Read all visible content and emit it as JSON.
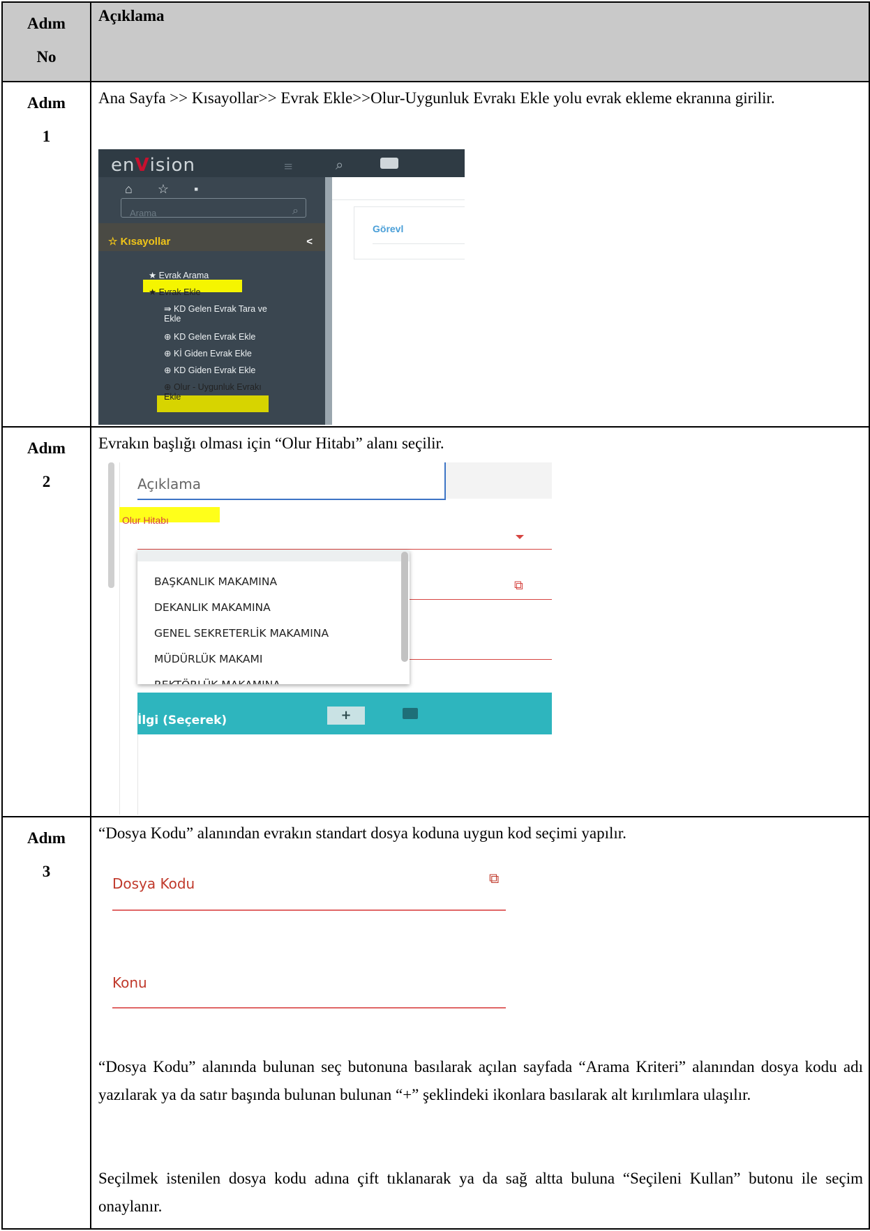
{
  "table": {
    "header": {
      "col1_line1": "Adım",
      "col1_line2": "No",
      "col2": "Açıklama"
    },
    "steps": [
      {
        "label_line1": "Adım",
        "label_line2": "1",
        "text": "Ana Sayfa >> Kısayollar>> Evrak Ekle>>Olur-Uygunluk Evrakı Ekle yolu evrak ekleme ekranına girilir."
      },
      {
        "label_line1": "Adım",
        "label_line2": "2",
        "text": "Evrakın başlığı olması için “Olur Hitabı” alanı seçilir."
      },
      {
        "label_line1": "Adım",
        "label_line2": "3",
        "text": "“Dosya Kodu” alanından evrakın standart dosya koduna uygun kod seçimi yapılır.",
        "text_after": "“Dosya Kodu” alanında bulunan seç butonuna basılarak açılan sayfada “Arama Kriteri” alanından dosya kodu adı yazılarak ya da satır başında bulunan bulunan “+” şeklindeki ikonlara basılarak alt kırılımlara ulaşılır.",
        "text_last": "Seçilmek istenilen dosya kodu adına çift tıklanarak ya da sağ altta buluna “Seçileni Kullan” butonu ile seçim onaylanır."
      }
    ]
  },
  "screenshot1": {
    "logo_left": "en",
    "logo_v": "V",
    "logo_right": "ision",
    "search_placeholder": "Arama",
    "shortcuts_label": "☆ Kısayollar",
    "shortcuts_chevron": "<",
    "menu": [
      "★ Evrak Arama",
      "★ Evrak Ekle",
      "⇛ KD Gelen Evrak Tara ve",
      "Ekle",
      "⊕ KD Gelen Evrak Ekle",
      "⊕ Kİ Giden Evrak Ekle",
      "⊕ KD Giden Evrak Ekle",
      "⊕ Olur - Uygunluk Evrakı",
      "Ekle"
    ],
    "card_title": "Görevl",
    "icons": [
      "home-icon",
      "star-icon",
      "help-icon",
      "search-icon",
      "briefcase-icon",
      "menu-icon"
    ]
  },
  "screenshot2": {
    "description_field": "Açıklama",
    "olur_label": "Olur Hitabı",
    "options": [
      "BAŞKANLIK MAKAMINA",
      "DEKANLIK MAKAMINA",
      "GENEL SEKRETERLİK MAKAMINA",
      "MÜDÜRLÜK MAKAMI",
      "REKTÖRLÜK MAKAMINA"
    ],
    "ilgi_label": "İlgi (Seçerek)",
    "plus": "+",
    "colors": {
      "teal": "#2eb5be",
      "red": "#d64541",
      "highlight": "#ffff1a"
    }
  },
  "screenshot3": {
    "dosya_kodu": "Dosya Kodu",
    "konu": "Konu"
  }
}
